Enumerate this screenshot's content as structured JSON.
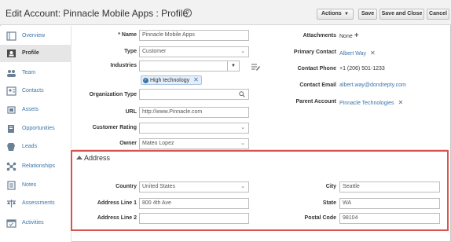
{
  "page": {
    "title": "Edit Account: Pinnacle Mobile Apps : Profile",
    "help_icon": "help-circle-icon"
  },
  "toolbar": {
    "actions_label": "Actions",
    "save_label": "Save",
    "save_close_label": "Save and Close",
    "cancel_label": "Cancel"
  },
  "sidebar": {
    "items": [
      {
        "label": "Overview",
        "icon": "overview-icon"
      },
      {
        "label": "Profile",
        "icon": "profile-icon"
      },
      {
        "label": "Team",
        "icon": "team-icon"
      },
      {
        "label": "Contacts",
        "icon": "contacts-icon"
      },
      {
        "label": "Assets",
        "icon": "assets-icon"
      },
      {
        "label": "Opportunities",
        "icon": "opportunities-icon"
      },
      {
        "label": "Leads",
        "icon": "leads-icon"
      },
      {
        "label": "Relationships",
        "icon": "relationships-icon"
      },
      {
        "label": "Notes",
        "icon": "notes-icon"
      },
      {
        "label": "Assessments",
        "icon": "assessments-icon"
      },
      {
        "label": "Activities",
        "icon": "activities-icon"
      }
    ]
  },
  "form": {
    "name_label": "Name",
    "name_required": "*",
    "name_value": "Pinnacle Mobile Apps",
    "type_label": "Type",
    "type_value": "Customer",
    "industries_label": "Industries",
    "industries_tag": "High technology",
    "org_type_label": "Organization Type",
    "url_label": "URL",
    "url_value": "http://www.Pinnacle.com",
    "rating_label": "Customer Rating",
    "owner_label": "Owner",
    "owner_value": "Mateo Lopez"
  },
  "right": {
    "attachments_label": "Attachments",
    "attachments_value": "None",
    "primary_contact_label": "Primary Contact",
    "primary_contact_value": "Albert Way",
    "contact_phone_label": "Contact Phone",
    "contact_phone_value": "+1 (206) 501-1233",
    "contact_email_label": "Contact Email",
    "contact_email_value": "albert.way@dondrepty.com",
    "parent_account_label": "Parent Account",
    "parent_account_value": "Pinnacle Technologies"
  },
  "address": {
    "section_title": "Address",
    "country_label": "Country",
    "country_value": "United States",
    "line1_label": "Address Line 1",
    "line1_value": "800 4th Ave",
    "line2_label": "Address Line 2",
    "line2_value": "",
    "city_label": "City",
    "city_value": "Seattle",
    "state_label": "State",
    "state_value": "WA",
    "postal_label": "Postal Code",
    "postal_value": "98104"
  },
  "colors": {
    "header_bg": "#f2f2f2",
    "link": "#3d74a8",
    "highlight_border": "#d9534f",
    "tag_bg": "#e3eef9"
  }
}
